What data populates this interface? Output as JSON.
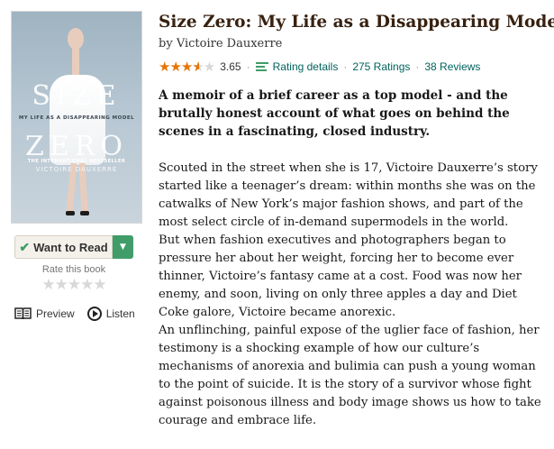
{
  "book": {
    "title": "Size Zero: My Life as a Disappearing Model",
    "by_prefix": "by",
    "author": "Victoire Dauxerre",
    "average_rating": "3.65",
    "star_rating_value": 3.65,
    "rating_details_label": "Rating details",
    "ratings_count": "275 Ratings",
    "reviews_count": "38 Reviews",
    "tagline": "A memoir of a brief career as a top model - and the brutally honest account of what goes on behind the scenes in a fascinating, closed industry.",
    "description": [
      "Scouted in the street when she is 17, Victoire Dauxerre’s story started like a teenager’s dream: within months she was on the catwalks of New York’s major fashion shows, and part of the most select circle of in-demand supermodels in the world.",
      "But when fashion executives and photographers began to pressure her about her weight, forcing her to become ever thinner, Victoire’s fantasy came at a cost. Food was now her enemy, and soon, living on only three apples a day and Diet Coke galore, Victoire became anorexic.",
      "An unflinching, painful expose of the uglier face of fashion, her testimony is a shocking example of how our culture’s mechanisms of anorexia and bulimia can push a young woman to the point of suicide. It is the story of a survivor whose fight against poisonous illness and body image shows us how to take courage and embrace life."
    ]
  },
  "cover": {
    "title_line1": "SIZE",
    "subtitle": "MY LIFE AS A DISAPPEARING MODEL",
    "title_line2": "ZERO",
    "bestseller": "THE INTERNATIONAL BESTSELLER",
    "author": "VICTOIRE DAUXERRE"
  },
  "sidebar": {
    "want_to_read_label": "Want to Read",
    "rate_label": "Rate this book",
    "user_rating_value": 0,
    "preview_label": "Preview",
    "listen_label": "Listen"
  },
  "icons": {
    "check": "check-icon",
    "dropdown": "chevron-down-icon",
    "preview": "open-book-icon",
    "listen": "play-circle-icon",
    "rating_details": "rating-bars-icon"
  },
  "colors": {
    "title": "#382110",
    "link": "#00635d",
    "accent_green": "#409d69",
    "star_orange": "#e87400",
    "star_empty": "#d8d8d8"
  }
}
